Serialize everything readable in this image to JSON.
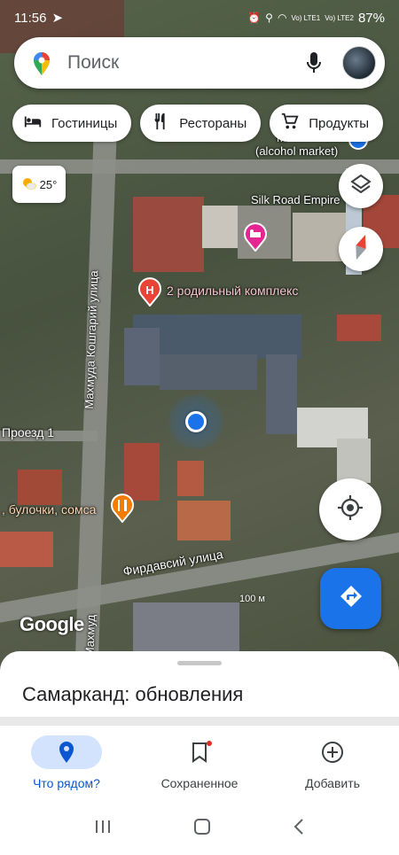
{
  "status_bar": {
    "time": "11:56",
    "net1": "Vo) LTE1",
    "net2": "Vo) LTE2",
    "battery": "87%"
  },
  "search": {
    "placeholder": "Поиск"
  },
  "chips": [
    {
      "label": "Гостиницы",
      "icon": "bed-icon"
    },
    {
      "label": "Рестораны",
      "icon": "fork-knife-icon"
    },
    {
      "label": "Продукты",
      "icon": "cart-icon"
    }
  ],
  "weather": {
    "temp": "25°",
    "icon": "partly-sunny-icon"
  },
  "map": {
    "labels": {
      "alcohol_market": "(alcohol market)",
      "market_prefix": "M",
      "silk_road": "Silk Road Empire",
      "maternity": "2 родильный комплекс",
      "street_koshgari": "Махмуда Кошгарий улица",
      "proezd": "Проезд 1",
      "bakery": ", булочки, сомса",
      "street_firdavsi": "Фирдавсий улица",
      "street_mahmud_cut": "Махмуд",
      "scale": "100 м"
    },
    "hospital_letter": "H"
  },
  "google_logo": "Google",
  "sheet": {
    "title": "Самарканд: обновления"
  },
  "nav": [
    {
      "label": "Что рядом?",
      "icon": "location-pin-icon",
      "active": true
    },
    {
      "label": "Сохраненное",
      "icon": "bookmark-icon",
      "active": false
    },
    {
      "label": "Добавить",
      "icon": "add-circle-icon",
      "active": false
    }
  ],
  "colors": {
    "accent": "#1a73e8",
    "active_nav_bg": "#d3e3fd",
    "hospital": "#ea4335",
    "hotel_pin": "#e52592"
  }
}
